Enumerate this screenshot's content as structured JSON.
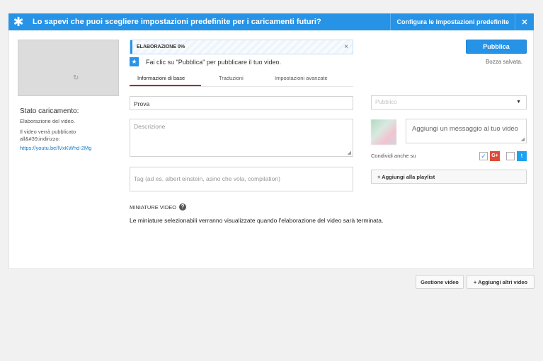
{
  "banner": {
    "message": "Lo sapevi che puoi scegliere impostazioni predefinite per i caricamenti futuri?",
    "configure_label": "Configura le impostazioni predefinite",
    "close_label": "✕"
  },
  "sidebar": {
    "spinner": "↻",
    "status_title": "Stato caricamento:",
    "status_processing": "Elaborazione del video.",
    "status_publish_line1": "Il video verrà pubblicato",
    "status_publish_line2": "all&#39;indirizzo:",
    "video_url": "https://youtu.be/lVxKWhd-2Mg"
  },
  "upload": {
    "progress_label": "ELABORAZIONE 0%",
    "progress_percent": 0,
    "cancel_label": "×",
    "publish_label": "Pubblica",
    "saved_status": "Bozza salvata.",
    "hint": "Fai clic su \"Pubblica\" per pubblicare il tuo video."
  },
  "tabs": [
    {
      "label": "Informazioni di base",
      "active": true
    },
    {
      "label": "Traduzioni",
      "active": false
    },
    {
      "label": "Impostazioni avanzate",
      "active": false
    }
  ],
  "form": {
    "title_value": "Prova",
    "description_placeholder": "Descrizione",
    "tags_placeholder": "Tag (ad es. albert einstein, asino che vola, compilation)"
  },
  "right_panel": {
    "privacy_value": "Pubblico",
    "message_placeholder": "Aggiungi un messaggio al tuo video",
    "share_label": "Condividi anche su",
    "gplus_label": "G+",
    "twitter_label": "t",
    "add_playlist_label": "+ Aggiungi alla playlist"
  },
  "thumbnails": {
    "title": "MINIATURE VIDEO",
    "help": "?",
    "description": "Le miniature selezionabili verranno visualizzate quando l'elaborazione del video sarà terminata."
  },
  "footer": {
    "manage_label": "Gestione video",
    "add_more_label": "+ Aggiungi altri video"
  },
  "colors": {
    "accent": "#2793e6",
    "tab_underline": "#cc181e",
    "gplus": "#dd4b39",
    "twitter": "#1da1f2"
  }
}
